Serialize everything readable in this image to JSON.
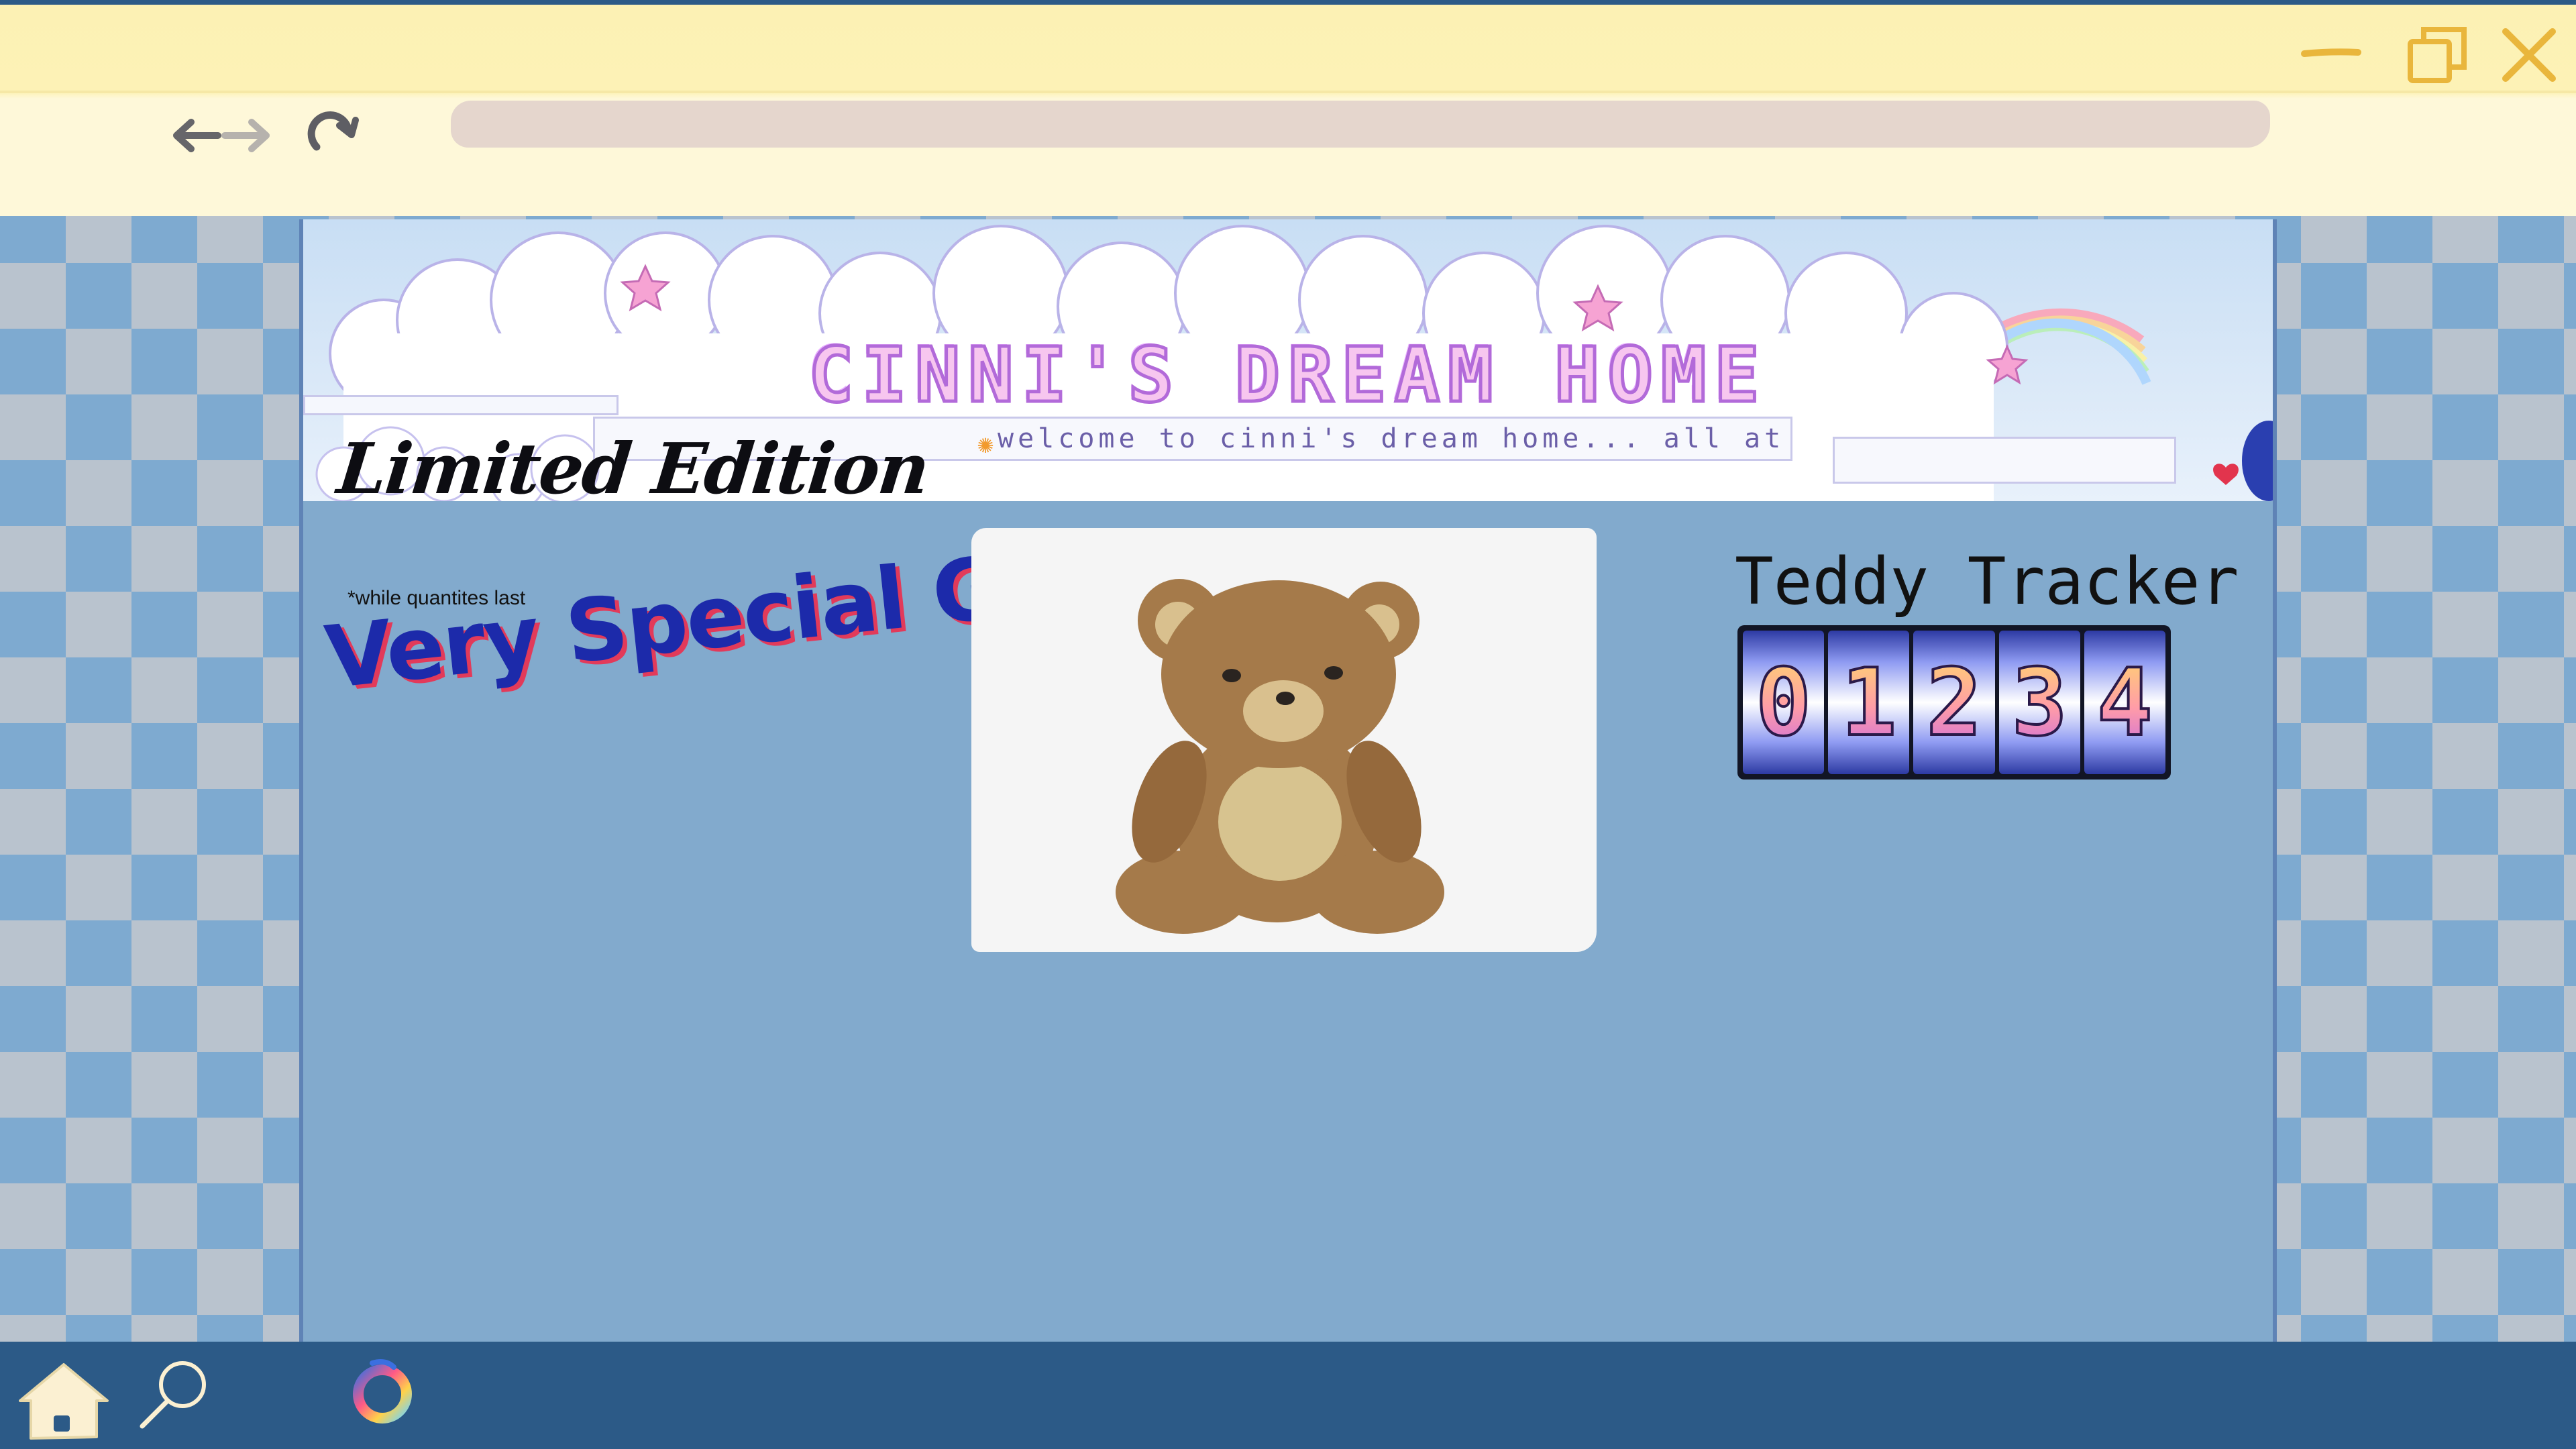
{
  "browser": {
    "address_value": "",
    "window_controls": [
      "minimize-icon",
      "maximize-icon",
      "close-icon"
    ],
    "nav_icons": [
      "back-arrow-icon",
      "forward-arrow-icon",
      "reload-icon"
    ]
  },
  "banner": {
    "title": "CINNI'S DREAM HOME",
    "marquee_text": "welcome to cinni's dream home... all at"
  },
  "promo": {
    "headline": "Limited Edition",
    "fineprint": "*while quantites last",
    "tagline": "Very Special Guy!"
  },
  "product": {
    "image": "teddy-bear-icon"
  },
  "tracker": {
    "title": "Teddy Tracker",
    "digits": [
      "0",
      "1",
      "2",
      "3",
      "4"
    ]
  },
  "taskbar": {
    "icons": [
      "home-icon",
      "search-icon",
      "app-launcher-icon"
    ]
  },
  "colors": {
    "chrome_bg": "#fdf2b6",
    "taskbar_bg": "#2c5a87",
    "page_bg": "#82aacd",
    "tagline_text": "#1c2aaa",
    "tagline_shadow": "#e23a5a"
  }
}
